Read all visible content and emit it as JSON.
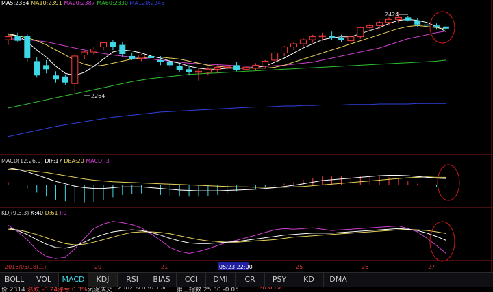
{
  "main_legend": [
    {
      "text": "MA5:2384",
      "color": "#ffffff"
    },
    {
      "text": "MA10:2391",
      "color": "#e6d15a"
    },
    {
      "text": "MA20:2387",
      "color": "#d040d0"
    },
    {
      "text": "MA60:2330",
      "color": "#30c030"
    },
    {
      "text": "MA120:2245",
      "color": "#3040e0"
    }
  ],
  "macd_legend": [
    {
      "text": "MACD(12,26,9)",
      "color": "#c8c8c8"
    },
    {
      "text": "DIF:17",
      "color": "#ffffff"
    },
    {
      "text": "DEA:20",
      "color": "#e6d15a"
    },
    {
      "text": "MACD:-3",
      "color": "#d040d0"
    }
  ],
  "kdj_legend": [
    {
      "text": "KDJ(9,3,3)",
      "color": "#c8c8c8"
    },
    {
      "text": "K:40",
      "color": "#ffffff"
    },
    {
      "text": "D:61",
      "color": "#e6d15a"
    },
    {
      "text": "J:0",
      "color": "#d040d0"
    }
  ],
  "annotations": {
    "high": "2424",
    "low": "2264"
  },
  "date_axis": [
    "2016/05/18(三)",
    "20",
    "21",
    "05/23 22:00",
    "25",
    "26",
    "27"
  ],
  "tabs": [
    "BOLL",
    "VOL",
    "MACD",
    "KDJ",
    "RSI",
    "BIAS",
    "CCI",
    "DMI",
    "CR",
    "PSY",
    "KD",
    "DMA"
  ],
  "active_tab": "MACD",
  "status": [
    "价 2314",
    "涨跌 -0.24",
    "浮亏 0.3%",
    "沉淀成交",
    "2382 -28 -0.1%",
    "第三指数 25.30 -0.05",
    "-0.05%"
  ],
  "colors": {
    "up": "#ff3b3b",
    "down": "#3fd6e6",
    "highlight_box": "#2020a0",
    "circle": "#d01818"
  },
  "chart_data": {
    "type": "candlestick",
    "candles": [
      [
        2370,
        2380,
        2360,
        2376
      ],
      [
        2378,
        2384,
        2366,
        2368
      ],
      [
        2378,
        2382,
        2326,
        2334
      ],
      [
        2328,
        2336,
        2296,
        2300
      ],
      [
        2320,
        2330,
        2304,
        2312
      ],
      [
        2300,
        2308,
        2286,
        2292
      ],
      [
        2298,
        2302,
        2282,
        2286
      ],
      [
        2284,
        2342,
        2266,
        2338
      ],
      [
        2340,
        2348,
        2332,
        2346
      ],
      [
        2346,
        2356,
        2340,
        2352
      ],
      [
        2356,
        2366,
        2350,
        2364
      ],
      [
        2366,
        2370,
        2350,
        2356
      ],
      [
        2360,
        2366,
        2336,
        2342
      ],
      [
        2338,
        2344,
        2330,
        2332
      ],
      [
        2334,
        2342,
        2328,
        2340
      ],
      [
        2338,
        2346,
        2330,
        2334
      ],
      [
        2330,
        2338,
        2320,
        2326
      ],
      [
        2326,
        2332,
        2316,
        2320
      ],
      [
        2318,
        2324,
        2306,
        2310
      ],
      [
        2312,
        2320,
        2300,
        2306
      ],
      [
        2306,
        2314,
        2290,
        2308
      ],
      [
        2306,
        2316,
        2300,
        2312
      ],
      [
        2312,
        2320,
        2304,
        2316
      ],
      [
        2316,
        2324,
        2310,
        2318
      ],
      [
        2320,
        2326,
        2308,
        2310
      ],
      [
        2312,
        2318,
        2304,
        2316
      ],
      [
        2314,
        2324,
        2310,
        2320
      ],
      [
        2318,
        2330,
        2314,
        2328
      ],
      [
        2330,
        2346,
        2326,
        2344
      ],
      [
        2344,
        2358,
        2338,
        2356
      ],
      [
        2356,
        2366,
        2350,
        2362
      ],
      [
        2362,
        2374,
        2356,
        2370
      ],
      [
        2370,
        2380,
        2364,
        2376
      ],
      [
        2376,
        2384,
        2368,
        2378
      ],
      [
        2378,
        2386,
        2370,
        2374
      ],
      [
        2374,
        2380,
        2366,
        2370
      ],
      [
        2368,
        2378,
        2352,
        2376
      ],
      [
        2376,
        2396,
        2372,
        2394
      ],
      [
        2394,
        2402,
        2388,
        2398
      ],
      [
        2398,
        2408,
        2392,
        2404
      ],
      [
        2404,
        2414,
        2398,
        2410
      ],
      [
        2410,
        2424,
        2404,
        2414
      ],
      [
        2414,
        2416,
        2406,
        2408
      ],
      [
        2408,
        2412,
        2396,
        2400
      ],
      [
        2400,
        2406,
        2394,
        2398
      ],
      [
        2398,
        2402,
        2390,
        2396
      ],
      [
        2396,
        2400,
        2388,
        2392
      ]
    ],
    "ma5": [
      2382,
      2378,
      2366,
      2350,
      2336,
      2318,
      2304,
      2300,
      2306,
      2318,
      2332,
      2346,
      2350,
      2348,
      2344,
      2338,
      2334,
      2328,
      2324,
      2318,
      2314,
      2312,
      2312,
      2314,
      2314,
      2314,
      2316,
      2318,
      2326,
      2334,
      2344,
      2354,
      2362,
      2370,
      2374,
      2376,
      2376,
      2382,
      2388,
      2394,
      2402,
      2408,
      2410,
      2408,
      2404,
      2396,
      2386
    ],
    "ma10": [
      2380,
      2378,
      2374,
      2368,
      2360,
      2350,
      2340,
      2330,
      2322,
      2318,
      2320,
      2324,
      2328,
      2332,
      2334,
      2336,
      2336,
      2334,
      2332,
      2328,
      2324,
      2320,
      2318,
      2316,
      2314,
      2314,
      2314,
      2314,
      2316,
      2320,
      2326,
      2332,
      2338,
      2344,
      2350,
      2356,
      2362,
      2368,
      2374,
      2380,
      2386,
      2392,
      2396,
      2398,
      2396,
      2394,
      2391
    ],
    "ma20": [
      2372,
      2371,
      2370,
      2368,
      2366,
      2362,
      2358,
      2354,
      2350,
      2346,
      2343,
      2340,
      2338,
      2336,
      2334,
      2332,
      2330,
      2328,
      2326,
      2324,
      2323,
      2322,
      2321,
      2320,
      2319,
      2318,
      2318,
      2318,
      2319,
      2320,
      2322,
      2324,
      2326,
      2330,
      2334,
      2338,
      2342,
      2346,
      2350,
      2354,
      2360,
      2366,
      2372,
      2376,
      2380,
      2384,
      2387
    ],
    "ma60": [
      2236,
      2240,
      2244,
      2248,
      2252,
      2256,
      2260,
      2264,
      2268,
      2272,
      2276,
      2280,
      2284,
      2288,
      2291,
      2294,
      2296,
      2298,
      2300,
      2302,
      2303,
      2304,
      2305,
      2306,
      2307,
      2308,
      2309,
      2310,
      2311,
      2312,
      2313,
      2314,
      2315,
      2316,
      2317,
      2318,
      2319,
      2320,
      2321,
      2322,
      2323,
      2324,
      2325,
      2326,
      2327,
      2328,
      2330
    ],
    "ma120": [
      2180,
      2184,
      2188,
      2192,
      2196,
      2200,
      2203,
      2206,
      2209,
      2212,
      2215,
      2218,
      2220,
      2222,
      2224,
      2226,
      2228,
      2229,
      2230,
      2231,
      2232,
      2233,
      2234,
      2235,
      2236,
      2237,
      2238,
      2238,
      2239,
      2240,
      2240,
      2241,
      2241,
      2242,
      2242,
      2242,
      2243,
      2243,
      2243,
      2244,
      2244,
      2244,
      2244,
      2245,
      2245,
      2245,
      2245
    ],
    "macd": {
      "dif": [
        44,
        40,
        34,
        26,
        18,
        10,
        4,
        -2,
        -6,
        -8,
        -8,
        -6,
        -4,
        -4,
        -4,
        -6,
        -8,
        -10,
        -12,
        -13,
        -14,
        -14,
        -14,
        -13,
        -12,
        -11,
        -10,
        -8,
        -6,
        -3,
        0,
        4,
        8,
        12,
        14,
        16,
        18,
        20,
        22,
        24,
        25,
        25,
        24,
        22,
        20,
        18,
        17
      ],
      "dea": [
        40,
        40,
        38,
        35,
        32,
        28,
        24,
        20,
        16,
        13,
        11,
        9,
        8,
        7,
        6,
        5,
        4,
        3,
        2,
        1,
        0,
        -1,
        -2,
        -3,
        -4,
        -4,
        -5,
        -5,
        -5,
        -5,
        -4,
        -3,
        -1,
        1,
        3,
        5,
        7,
        9,
        11,
        13,
        15,
        17,
        19,
        20,
        21,
        20,
        20
      ],
      "hist": [
        8,
        0,
        -8,
        -18,
        -28,
        -36,
        -40,
        -44,
        -44,
        -42,
        -38,
        -30,
        -24,
        -22,
        -20,
        -22,
        -24,
        -26,
        -28,
        -28,
        -28,
        -26,
        -24,
        -20,
        -16,
        -14,
        -10,
        -6,
        -2,
        4,
        8,
        14,
        18,
        22,
        22,
        22,
        22,
        22,
        22,
        22,
        20,
        16,
        10,
        4,
        -2,
        -4,
        -6
      ]
    },
    "kdj": {
      "k": [
        78,
        70,
        58,
        42,
        28,
        18,
        16,
        22,
        34,
        48,
        58,
        66,
        70,
        72,
        70,
        64,
        56,
        46,
        38,
        32,
        30,
        30,
        32,
        34,
        36,
        40,
        44,
        48,
        52,
        56,
        58,
        60,
        62,
        62,
        62,
        64,
        66,
        68,
        70,
        72,
        74,
        76,
        74,
        70,
        62,
        52,
        40
      ],
      "d": [
        74,
        72,
        66,
        58,
        48,
        38,
        30,
        26,
        28,
        34,
        42,
        50,
        58,
        64,
        66,
        66,
        64,
        60,
        54,
        48,
        42,
        38,
        36,
        34,
        34,
        36,
        38,
        40,
        42,
        46,
        50,
        52,
        54,
        56,
        58,
        60,
        62,
        64,
        66,
        68,
        70,
        72,
        73,
        72,
        70,
        66,
        61
      ],
      "j": [
        86,
        66,
        42,
        10,
        -10,
        -16,
        -12,
        14,
        46,
        76,
        90,
        98,
        94,
        88,
        78,
        60,
        40,
        18,
        6,
        0,
        6,
        14,
        24,
        34,
        40,
        48,
        56,
        64,
        72,
        76,
        74,
        76,
        78,
        74,
        70,
        72,
        74,
        76,
        78,
        80,
        82,
        84,
        76,
        66,
        46,
        24,
        0
      ]
    }
  }
}
